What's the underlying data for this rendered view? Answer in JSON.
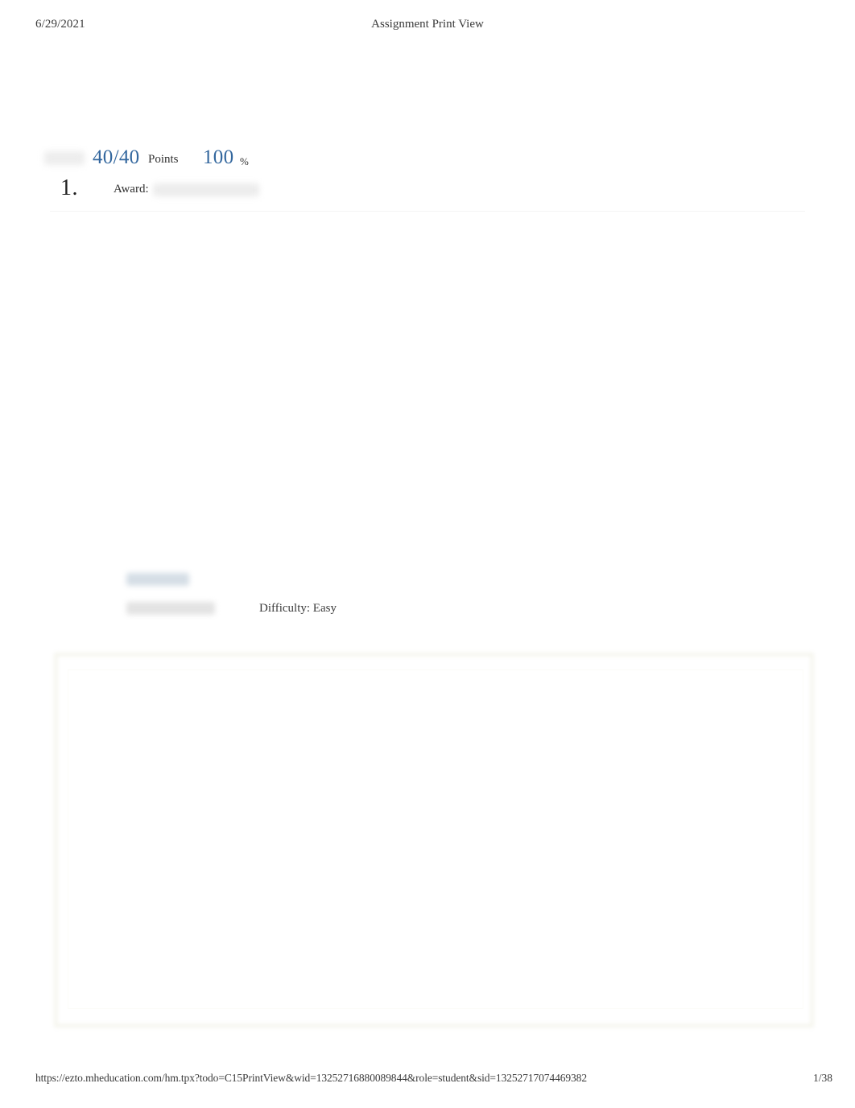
{
  "document": {
    "title": "Assignment Print View",
    "date": "6/29/2021",
    "page_indicator": "1/38",
    "footer_url": "https://ezto.mheducation.com/hm.tpx?todo=C15PrintView&wid=13252716880089844&role=student&sid=13252717074469382",
    "accent_color": "#33679E",
    "body_text_color": "#2B2B2B",
    "frame_border_color": "#F2F2E8",
    "redaction_color": "#ECECEC"
  },
  "score": {
    "label_redacted": "",
    "points_value": "40/40",
    "points_unit": "Points",
    "percent_value": "100",
    "percent_sign": "%"
  },
  "question": {
    "number": "1.",
    "award_label": "Award:",
    "award_value_redacted": ""
  },
  "meta": {
    "tag_redacted_1": "",
    "tag_redacted_2": "",
    "difficulty": "Difficulty: Easy"
  }
}
